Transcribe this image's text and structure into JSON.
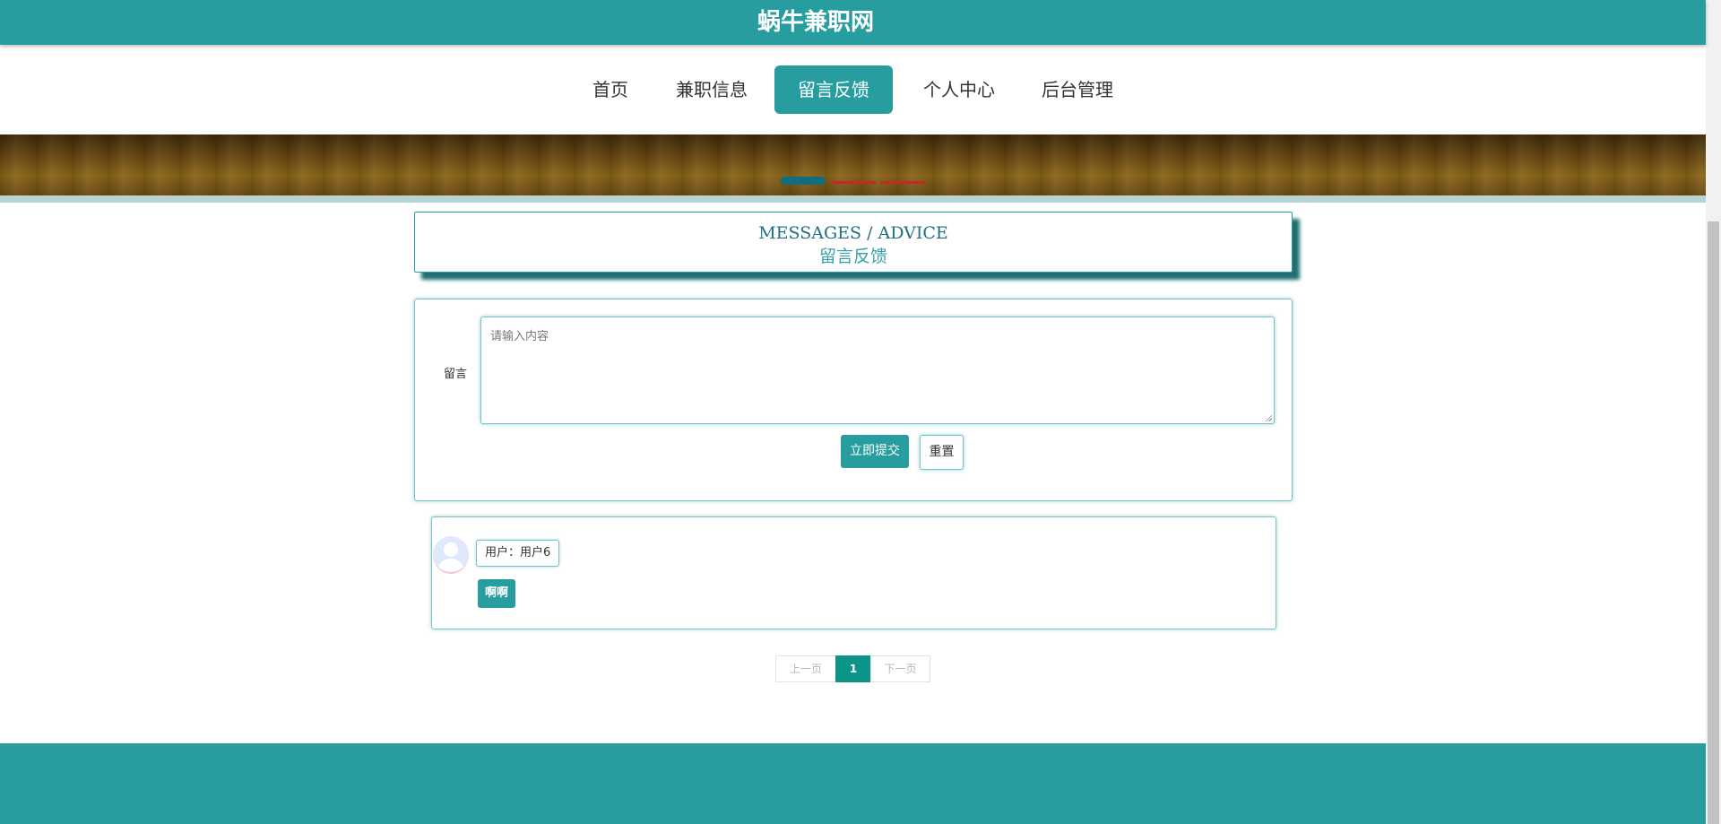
{
  "header": {
    "site_title": "蜗牛兼职网"
  },
  "nav": {
    "items": [
      {
        "label": "首页",
        "active": false
      },
      {
        "label": "兼职信息",
        "active": false
      },
      {
        "label": "留言反馈",
        "active": true
      },
      {
        "label": "个人中心",
        "active": false
      },
      {
        "label": "后台管理",
        "active": false
      }
    ]
  },
  "carousel": {
    "slide_count": 3,
    "active_index": 0
  },
  "section": {
    "title_en": "MESSAGES / ADVICE",
    "title_cn": "留言反馈"
  },
  "form": {
    "label": "留言",
    "placeholder": "请输入内容",
    "value": "",
    "submit_label": "立即提交",
    "reset_label": "重置"
  },
  "messages": [
    {
      "user": "用户：用户6",
      "content": "啊啊",
      "avatar_icon": "user-avatar-icon"
    }
  ],
  "pagination": {
    "prev_label": "上一页",
    "current_page": "1",
    "next_label": "下一页"
  },
  "colors": {
    "primary": "#279d9f",
    "page_active": "#0d9488",
    "carousel_active": "#0f6f80",
    "carousel_inactive": "#c62828"
  }
}
